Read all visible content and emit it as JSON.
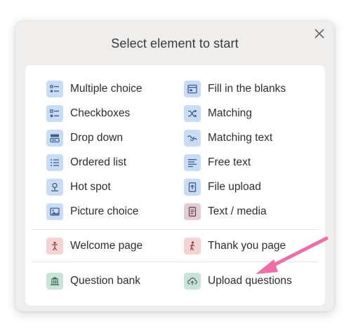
{
  "dialog": {
    "title": "Select element to start",
    "close_icon": "close-icon"
  },
  "left_items": [
    {
      "label": "Multiple choice",
      "icon": "multiple-choice-icon"
    },
    {
      "label": "Checkboxes",
      "icon": "checkboxes-icon"
    },
    {
      "label": "Drop down",
      "icon": "dropdown-icon"
    },
    {
      "label": "Ordered list",
      "icon": "ordered-list-icon"
    },
    {
      "label": "Hot spot",
      "icon": "hot-spot-icon"
    },
    {
      "label": "Picture choice",
      "icon": "picture-choice-icon"
    }
  ],
  "right_items": [
    {
      "label": "Fill in the blanks",
      "icon": "fill-blanks-icon"
    },
    {
      "label": "Matching",
      "icon": "matching-icon"
    },
    {
      "label": "Matching text",
      "icon": "matching-text-icon"
    },
    {
      "label": "Free text",
      "icon": "free-text-icon"
    },
    {
      "label": "File upload",
      "icon": "file-upload-icon"
    },
    {
      "label": "Text / media",
      "icon": "text-media-icon"
    }
  ],
  "pages": {
    "welcome": "Welcome page",
    "thank_you": "Thank you page"
  },
  "bank": {
    "question_bank": "Question bank",
    "upload_questions": "Upload questions"
  },
  "colors": {
    "question_icon_bg": "#c9dcf6",
    "page_icon_bg": "#f3d3d3",
    "media_icon_bg": "#e3cdd4",
    "bank_icon_bg": "#c9e3d9",
    "arrow": "#ee6fa8"
  }
}
